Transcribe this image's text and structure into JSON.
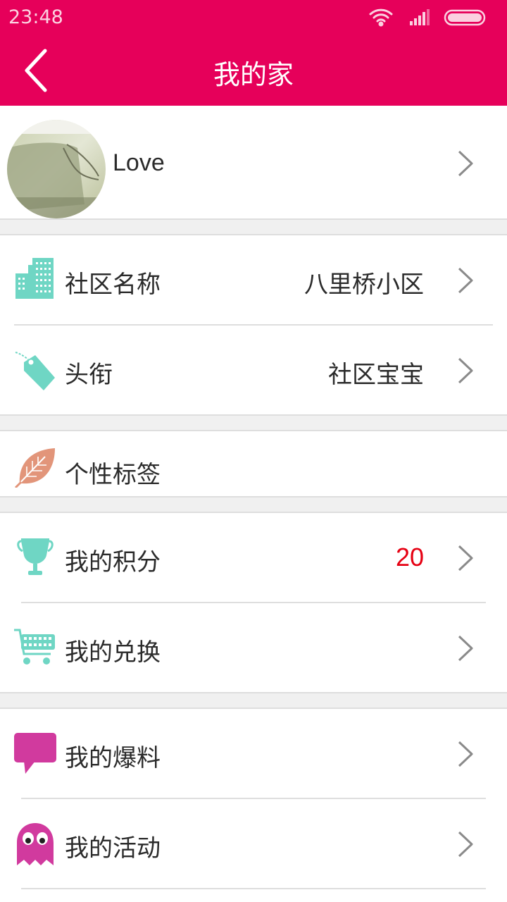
{
  "status_bar": {
    "time": "23:48"
  },
  "header": {
    "title": "我的家",
    "back_icon": "chevron-left-icon"
  },
  "profile": {
    "username": "Love",
    "avatar": "user-avatar-photo"
  },
  "rows": {
    "community": {
      "label": "社区名称",
      "value": "八里桥小区",
      "icon": "building-icon"
    },
    "title": {
      "label": "头衔",
      "value": "社区宝宝",
      "icon": "tag-icon"
    },
    "tags": {
      "label": "个性标签",
      "icon": "leaf-icon"
    },
    "points": {
      "label": "我的积分",
      "value": "20",
      "icon": "trophy-icon"
    },
    "exchange": {
      "label": "我的兑换",
      "icon": "cart-icon"
    },
    "reports": {
      "label": "我的爆料",
      "icon": "speech-bubble-icon"
    },
    "activities": {
      "label": "我的活动",
      "icon": "ghost-icon"
    }
  },
  "colors": {
    "brand": "#e6005a",
    "teal_icon": "#6fd6c4",
    "leaf_icon": "#e2957a",
    "magenta_icon": "#d13a9e",
    "points_value": "#e60012"
  }
}
